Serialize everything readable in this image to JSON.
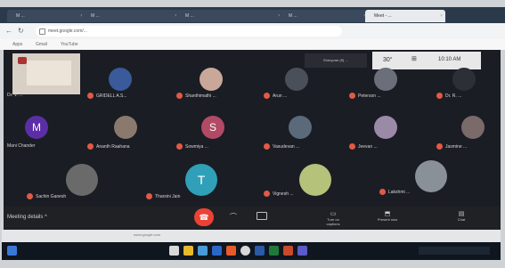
{
  "browser": {
    "tabs": [
      {
        "label": "M ..."
      },
      {
        "label": "M  ..."
      },
      {
        "label": "M  ..."
      },
      {
        "label": "M  ..."
      },
      {
        "label": "Meet - ..."
      }
    ],
    "url": "meet.google.com/...",
    "bookmarks": [
      "Apps",
      "Gmail",
      "YouTube"
    ]
  },
  "meet": {
    "top_bar": {
      "presenting": "Everyone (9) ...",
      "temp": "30°",
      "time": "10:10 AM"
    },
    "participants": [
      {
        "name": "Dr. V. ...",
        "avatar": "photo"
      },
      {
        "name": "GRIDELL A.S...",
        "avatar": "photo"
      },
      {
        "name": "Shanthimathi ...",
        "avatar": "photo"
      },
      {
        "name": "Arun ...",
        "avatar": "photo"
      },
      {
        "name": "Peterson ...",
        "avatar": "photo"
      },
      {
        "name": "Dr. R. ...",
        "avatar": "photo"
      },
      {
        "name": "Mani Chander",
        "avatar": "letter",
        "letter": "M",
        "color": "#5b2ea6"
      },
      {
        "name": "Ananth Raahana",
        "avatar": "photo"
      },
      {
        "name": "Sowmiya ...",
        "avatar": "letter",
        "letter": "S",
        "color": "#b24a66"
      },
      {
        "name": "Vasudevan ...",
        "avatar": "photo"
      },
      {
        "name": "Jeevan ...",
        "avatar": "photo"
      },
      {
        "name": "Jasmine ...",
        "avatar": "photo"
      },
      {
        "name": "Sachin Ganesh",
        "avatar": "photo"
      },
      {
        "name": "Tharsini Jain",
        "avatar": "letter",
        "letter": "T",
        "color": "#2fa0b8"
      },
      {
        "name": "Vignesh ...",
        "avatar": "photo"
      },
      {
        "name": "Lakshmi ...",
        "avatar": "photo"
      }
    ],
    "controls": {
      "meeting_label": "Meeting details",
      "chevron": "^",
      "end_call_color": "#ea4335",
      "right_buttons": [
        "Turn on captions",
        "Present now",
        "Chat"
      ]
    }
  },
  "status_strip": {
    "text": "www.google.com"
  },
  "taskbar": {
    "icons": [
      "start-icon",
      "search-icon",
      "task-view-icon",
      "explorer-icon",
      "chrome-icon",
      "edge-icon",
      "store-icon",
      "mail-icon",
      "word-icon",
      "excel-icon",
      "ppt-icon",
      "teams-icon"
    ]
  }
}
